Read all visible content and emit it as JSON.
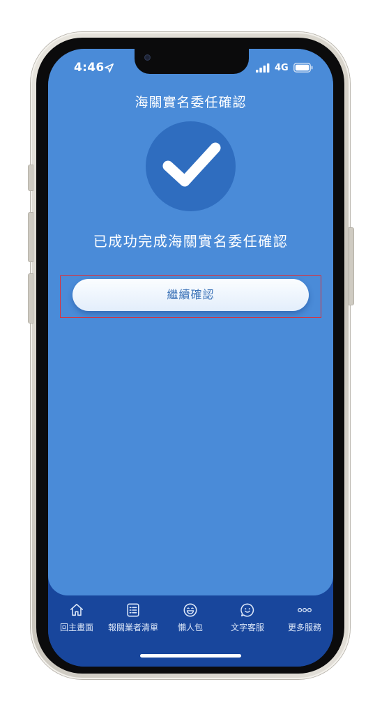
{
  "status_bar": {
    "time": "4:46",
    "network": "4G",
    "icons": [
      "location-arrow-icon",
      "signal-bars-icon",
      "battery-icon"
    ]
  },
  "page": {
    "title": "海關實名委任確認",
    "success_message": "已成功完成海關實名委任確認",
    "success_icon": "checkmark-icon",
    "continue_button_label": "繼續確認"
  },
  "tab_bar": {
    "items": [
      {
        "label": "回主畫面",
        "icon": "home-icon"
      },
      {
        "label": "報關業者清單",
        "icon": "list-icon"
      },
      {
        "label": "懶人包",
        "icon": "smiley-grin-icon"
      },
      {
        "label": "文字客服",
        "icon": "chat-smiley-icon"
      },
      {
        "label": "更多服務",
        "icon": "more-dots-icon"
      }
    ]
  },
  "colors": {
    "background": "#4a8bd8",
    "tab_bar": "#18469c",
    "check_circle": "#2f6dbf",
    "button_text": "#3c73b8",
    "highlight_border": "#d9333d"
  }
}
